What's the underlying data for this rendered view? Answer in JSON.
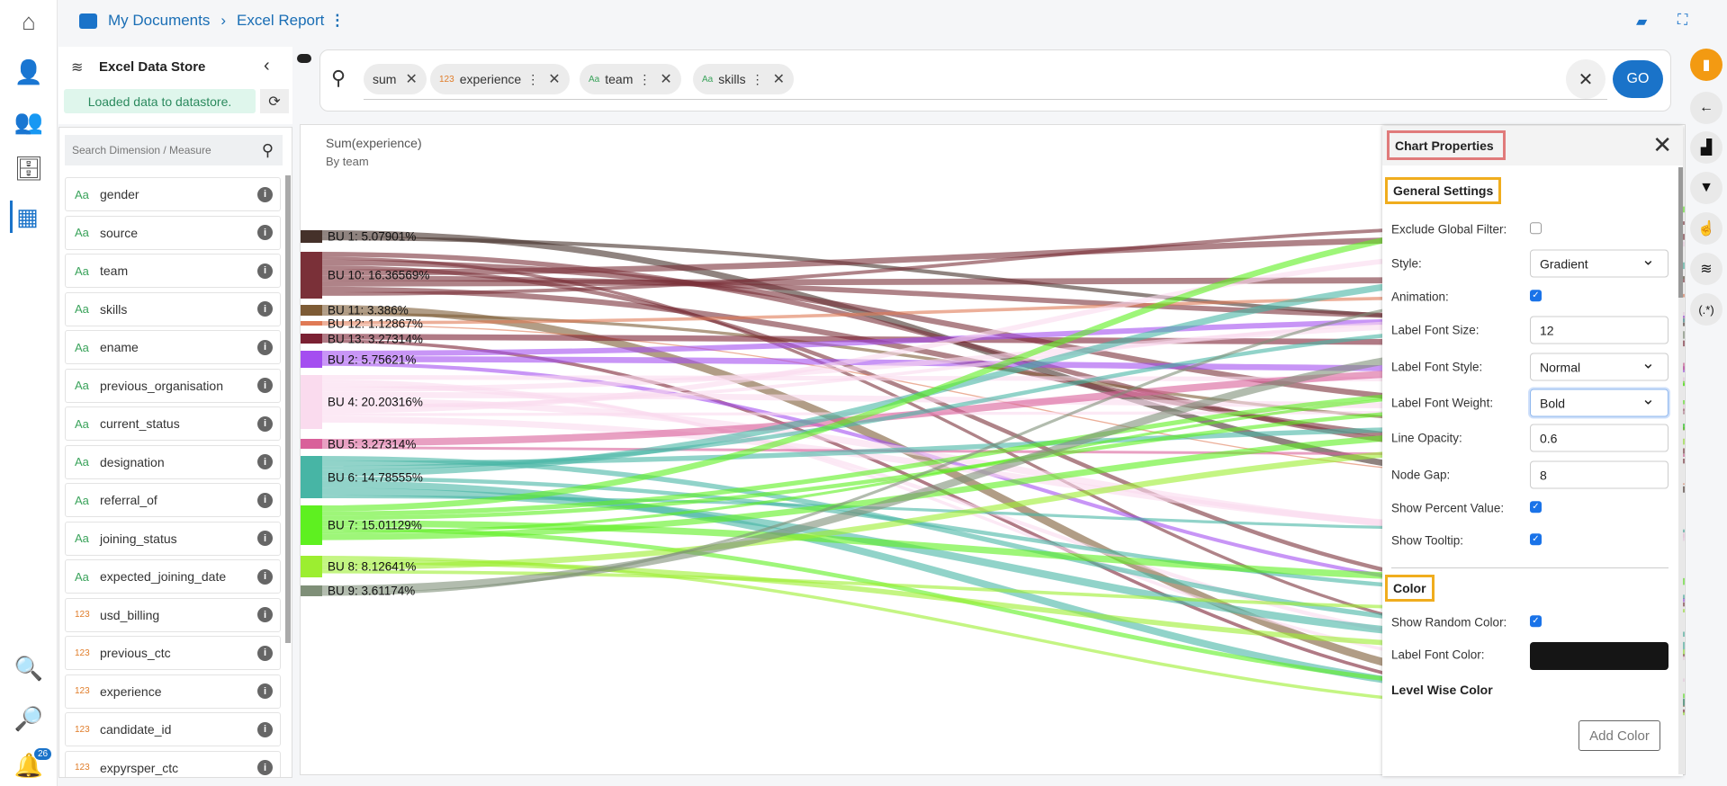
{
  "breadcrumb": {
    "root": "My Documents",
    "separator": "›",
    "current": "Excel Report"
  },
  "notifications": {
    "count": "26"
  },
  "datastore": {
    "title": "Excel Data Store",
    "status": "Loaded data to datastore.",
    "search_placeholder": "Search Dimension / Measure",
    "fields": [
      {
        "type": "Aa",
        "name": "gender"
      },
      {
        "type": "Aa",
        "name": "source"
      },
      {
        "type": "Aa",
        "name": "team"
      },
      {
        "type": "Aa",
        "name": "skills"
      },
      {
        "type": "Aa",
        "name": "ename"
      },
      {
        "type": "Aa",
        "name": "previous_organisation"
      },
      {
        "type": "Aa",
        "name": "current_status"
      },
      {
        "type": "Aa",
        "name": "designation"
      },
      {
        "type": "Aa",
        "name": "referral_of"
      },
      {
        "type": "Aa",
        "name": "joining_status"
      },
      {
        "type": "Aa",
        "name": "expected_joining_date"
      },
      {
        "type": "123",
        "name": "usd_billing"
      },
      {
        "type": "123",
        "name": "previous_ctc"
      },
      {
        "type": "123",
        "name": "experience"
      },
      {
        "type": "123",
        "name": "candidate_id"
      },
      {
        "type": "123",
        "name": "expyrsper_ctc"
      }
    ]
  },
  "search": {
    "chips": [
      {
        "type": "",
        "label": "sum"
      },
      {
        "type": "123",
        "label": "experience"
      },
      {
        "type": "Aa",
        "label": "team"
      },
      {
        "type": "Aa",
        "label": "skills"
      }
    ],
    "go": "GO"
  },
  "chart_data": {
    "type": "sankey",
    "title": "Sum(experience)",
    "subtitle": "By team",
    "nodes": [
      {
        "name": "BU 1",
        "percent": 5.07901,
        "label": "BU 1: 5.07901%",
        "color": "#45312a"
      },
      {
        "name": "BU 10",
        "percent": 16.36569,
        "label": "BU 10: 16.36569%",
        "color": "#7a3038"
      },
      {
        "name": "BU 11",
        "percent": 3.386,
        "label": "BU 11: 3.386%",
        "color": "#7d5b35"
      },
      {
        "name": "BU 12",
        "percent": 1.12867,
        "label": "BU 12: 1.12867%",
        "color": "#e07a55"
      },
      {
        "name": "BU 13",
        "percent": 3.27314,
        "label": "BU 13: 3.27314%",
        "color": "#7b2133"
      },
      {
        "name": "BU 2",
        "percent": 5.75621,
        "label": "BU 2: 5.75621%",
        "color": "#a44ef0"
      },
      {
        "name": "BU 4",
        "percent": 20.20316,
        "label": "BU 4: 20.20316%",
        "color": "#fadbee"
      },
      {
        "name": "BU 5",
        "percent": 3.27314,
        "label": "BU 5: 3.27314%",
        "color": "#d9609a"
      },
      {
        "name": "BU 6",
        "percent": 14.78555,
        "label": "BU 6: 14.78555%",
        "color": "#47b5a5"
      },
      {
        "name": "BU 7",
        "percent": 15.01129,
        "label": "BU 7: 15.01129%",
        "color": "#5ef020"
      },
      {
        "name": "BU 8",
        "percent": 8.12641,
        "label": "BU 8: 8.12641%",
        "color": "#9cee30"
      },
      {
        "name": "BU 9",
        "percent": 3.61174,
        "label": "BU 9: 3.61174%",
        "color": "#7f8f78"
      }
    ]
  },
  "properties": {
    "title": "Chart Properties",
    "general": "General Settings",
    "exclude_global_filter": {
      "label": "Exclude Global Filter:",
      "checked": false
    },
    "style": {
      "label": "Style:",
      "value": "Gradient"
    },
    "animation": {
      "label": "Animation:",
      "checked": true
    },
    "label_font_size": {
      "label": "Label Font Size:",
      "value": "12"
    },
    "label_font_style": {
      "label": "Label Font Style:",
      "value": "Normal"
    },
    "label_font_weight": {
      "label": "Label Font Weight:",
      "value": "Bold"
    },
    "line_opacity": {
      "label": "Line Opacity:",
      "value": "0.6"
    },
    "node_gap": {
      "label": "Node Gap:",
      "value": "8"
    },
    "show_percent": {
      "label": "Show Percent Value:",
      "checked": true
    },
    "show_tooltip": {
      "label": "Show Tooltip:",
      "checked": true
    },
    "color_section": "Color",
    "show_random_color": {
      "label": "Show Random Color:",
      "checked": true
    },
    "label_font_color": {
      "label": "Label Font Color:",
      "value": "#151515"
    },
    "level_wise_color": "Level Wise Color",
    "add_color": "Add Color"
  },
  "right_rail": {
    "regex_label": "(.*)"
  }
}
